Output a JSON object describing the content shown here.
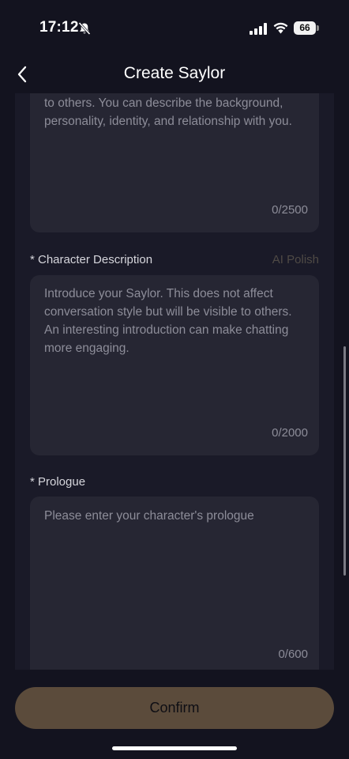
{
  "status_bar": {
    "time": "17:12",
    "battery": "66"
  },
  "header": {
    "title": "Create Saylor"
  },
  "form": {
    "setting_box": {
      "visible_text": "to others. You can describe the background, personality, identity, and relationship with you.",
      "counter": "0/2500"
    },
    "description": {
      "label": "* Character Description",
      "ai_polish": "AI Polish",
      "placeholder": "Introduce your Saylor. This does not affect conversation style but will be visible to others. An interesting introduction can make chatting more engaging.",
      "counter": "0/2000"
    },
    "prologue": {
      "label": "* Prologue",
      "placeholder": "Please enter your character's prologue",
      "counter": "0/600"
    }
  },
  "confirm_label": "Confirm",
  "colors": {
    "background": "#13131f",
    "panel": "#1a1a28",
    "input": "#262633",
    "button": "#5b4b3b",
    "muted_text": "#8d8d99"
  },
  "icons": [
    "bell-slash-icon",
    "signal-icon",
    "wifi-icon",
    "battery-icon",
    "back-chevron-icon"
  ]
}
